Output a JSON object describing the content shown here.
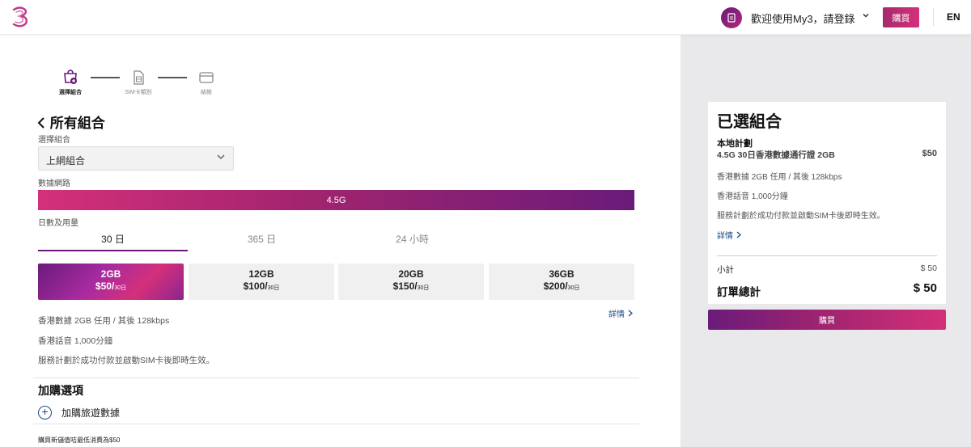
{
  "header": {
    "welcome_text": "歡迎使用My3，請登錄",
    "buy_label": "購買",
    "lang_label": "EN"
  },
  "steps": [
    {
      "label": "選擇組合",
      "active": true
    },
    {
      "label": "SIM卡類別",
      "active": false
    },
    {
      "label": "結帳",
      "active": false
    }
  ],
  "main": {
    "title": "所有組合",
    "combo_label": "選擇組合",
    "combo_value": "上網組合",
    "network_label": "數據網路",
    "network_value": "4.5G",
    "usage_label": "日數及用量",
    "tabs": [
      "30 日",
      "365 日",
      "24 小時"
    ],
    "plans": [
      {
        "data": "2GB",
        "price": "$50/",
        "unit": "30日"
      },
      {
        "data": "12GB",
        "price": "$100/",
        "unit": "30日"
      },
      {
        "data": "20GB",
        "price": "$150/",
        "unit": "30日"
      },
      {
        "data": "36GB",
        "price": "$200/",
        "unit": "30日"
      }
    ],
    "details_link": "詳情",
    "desc": [
      "香港數據 2GB 任用 / 其後 128kbps",
      "香港話音 1,000分鐘",
      "服務計劃於成功付款並啟動SIM卡後即時生效。"
    ],
    "addon_title": "加購選項",
    "addon_label": "加購旅遊數據",
    "footnote": "購買新儲值咭最低消費為$50"
  },
  "summary": {
    "title": "已選組合",
    "subtitle": "本地計劃",
    "plan_name": "4.5G 30日香港數據通行證 2GB",
    "plan_price": "$50",
    "desc": [
      "香港數據 2GB 任用 / 其後 128kbps",
      "香港話音 1,000分鐘",
      "服務計劃於成功付款並啟動SIM卡後即時生效。"
    ],
    "details_link": "詳情",
    "subtotal_label": "小計",
    "subtotal_value": "$ 50",
    "total_label": "訂單總計",
    "total_value": "$ 50",
    "buy_label": "購買"
  },
  "colors": {
    "brand_purple": "#6a1b7a",
    "brand_magenta": "#d4307a",
    "link_blue": "#1e4a8a"
  }
}
